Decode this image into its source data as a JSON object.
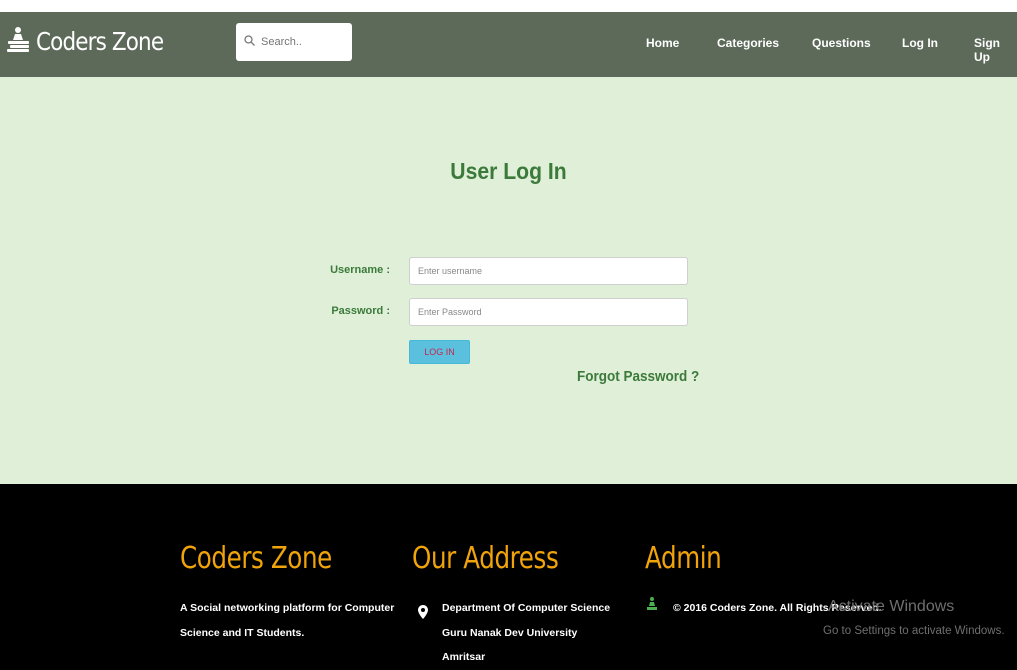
{
  "header": {
    "brand": "Coders Zone",
    "search_placeholder": "Search..",
    "nav": [
      "Home",
      "Categories",
      "Questions",
      "Log In",
      "Sign Up"
    ]
  },
  "login": {
    "title": "User Log In",
    "username_label": "Username :",
    "username_placeholder": "Enter username",
    "password_label": "Password :",
    "password_placeholder": "Enter Password",
    "submit_label": "LOG IN",
    "forgot_label": "Forgot Password ?"
  },
  "footer": {
    "about": {
      "heading": "Coders Zone",
      "line1": "A Social networking platform for Computer",
      "line2": "Science and IT Students."
    },
    "address": {
      "heading": "Our Address",
      "line1": "Department Of Computer Science",
      "line2": "Guru Nanak Dev University",
      "line3": "Amritsar"
    },
    "admin": {
      "heading": "Admin",
      "copyright": "© 2016 Coders Zone. All Rights Reserved."
    }
  },
  "os_overlay": {
    "line1": "Activate Windows",
    "line2": "Go to Settings to activate Windows."
  },
  "colors": {
    "navbar": "#5d6a5a",
    "main_bg": "#dfefd8",
    "accent_green": "#3c7a3b",
    "footer_heading": "#f0a30a",
    "button": "#5bc0de"
  },
  "icons": [
    "coders-zone-logo-icon",
    "search-icon",
    "map-pin-icon",
    "admin-chess-icon"
  ]
}
